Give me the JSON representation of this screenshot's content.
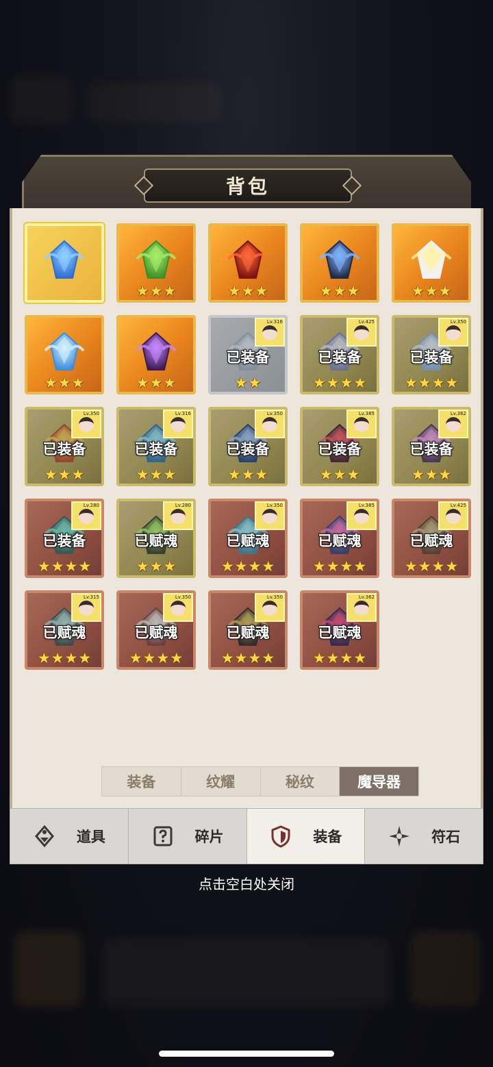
{
  "title": "背包",
  "items": [
    {
      "status": "",
      "stars": 0,
      "bg": "gold",
      "art": "blue-crystal",
      "avatar": false
    },
    {
      "status": "",
      "stars": 3,
      "bg": "gold",
      "art": "green-crystal",
      "avatar": false
    },
    {
      "status": "",
      "stars": 3,
      "bg": "gold",
      "art": "red-eye-orb",
      "avatar": false
    },
    {
      "status": "",
      "stars": 3,
      "bg": "gold",
      "art": "dark-wing-gem",
      "avatar": false
    },
    {
      "status": "",
      "stars": 3,
      "bg": "gold",
      "art": "star-wings",
      "avatar": false
    },
    {
      "status": "",
      "stars": 3,
      "bg": "gold",
      "art": "water-drop",
      "avatar": false
    },
    {
      "status": "",
      "stars": 3,
      "bg": "gold",
      "art": "purple-gem",
      "avatar": false
    },
    {
      "status": "已装备",
      "stars": 2,
      "bg": "gray",
      "art": "ice-relic",
      "avatar": true,
      "lv": "Lv.316"
    },
    {
      "status": "已装备",
      "stars": 4,
      "bg": "olive",
      "art": "crown-relic",
      "avatar": true,
      "lv": "Lv.425"
    },
    {
      "status": "已装备",
      "stars": 4,
      "bg": "olive",
      "art": "wing-relic",
      "avatar": true,
      "lv": "Lv.350"
    },
    {
      "status": "已装备",
      "stars": 3,
      "bg": "olive",
      "art": "gold-relic",
      "avatar": true,
      "lv": "Lv.350"
    },
    {
      "status": "已装备",
      "stars": 3,
      "bg": "olive",
      "art": "lyre-relic",
      "avatar": true,
      "lv": "Lv.316"
    },
    {
      "status": "已装备",
      "stars": 3,
      "bg": "olive",
      "art": "compass-relic",
      "avatar": true,
      "lv": "Lv.350"
    },
    {
      "status": "已装备",
      "stars": 3,
      "bg": "olive",
      "art": "rose-relic",
      "avatar": true,
      "lv": "Lv.385"
    },
    {
      "status": "已装备",
      "stars": 3,
      "bg": "olive",
      "art": "orb-relic",
      "avatar": true,
      "lv": "Lv.362"
    },
    {
      "status": "已装备",
      "stars": 4,
      "bg": "red",
      "art": "serpent-ring",
      "avatar": true,
      "lv": "Lv.280"
    },
    {
      "status": "已赋魂",
      "stars": 3,
      "bg": "olive",
      "art": "skull-relic",
      "avatar": true,
      "lv": "Lv.280"
    },
    {
      "status": "已赋魂",
      "stars": 4,
      "bg": "red",
      "art": "triangle-relic",
      "avatar": true,
      "lv": "Lv.350"
    },
    {
      "status": "已赋魂",
      "stars": 4,
      "bg": "red",
      "art": "star-banner",
      "avatar": true,
      "lv": "Lv.385"
    },
    {
      "status": "已赋魂",
      "stars": 4,
      "bg": "red",
      "art": "astrolabe",
      "avatar": true,
      "lv": "Lv.425"
    },
    {
      "status": "已赋魂",
      "stars": 4,
      "bg": "red",
      "art": "lantern",
      "avatar": true,
      "lv": "Lv.315"
    },
    {
      "status": "已赋魂",
      "stars": 4,
      "bg": "red",
      "art": "tower-relic",
      "avatar": true,
      "lv": "Lv.350"
    },
    {
      "status": "已赋魂",
      "stars": 4,
      "bg": "red",
      "art": "shadow-shield",
      "avatar": true,
      "lv": "Lv.350"
    },
    {
      "status": "已赋魂",
      "stars": 4,
      "bg": "red",
      "art": "dark-orb",
      "avatar": true,
      "lv": "Lv.362"
    }
  ],
  "subtabs": [
    "装备",
    "纹耀",
    "秘纹",
    "魔导器"
  ],
  "active_subtab": 3,
  "bottom_tabs": [
    {
      "label": "道具",
      "icon": "potion-icon"
    },
    {
      "label": "碎片",
      "icon": "question-card-icon"
    },
    {
      "label": "装备",
      "icon": "shield-icon"
    },
    {
      "label": "符石",
      "icon": "sparkle-icon"
    }
  ],
  "active_bottom_tab": 2,
  "close_hint": "点击空白处关闭",
  "colors": {
    "star": "#ffd84a",
    "active_subtab": "#7e7064",
    "panel": "#ece6dc"
  }
}
